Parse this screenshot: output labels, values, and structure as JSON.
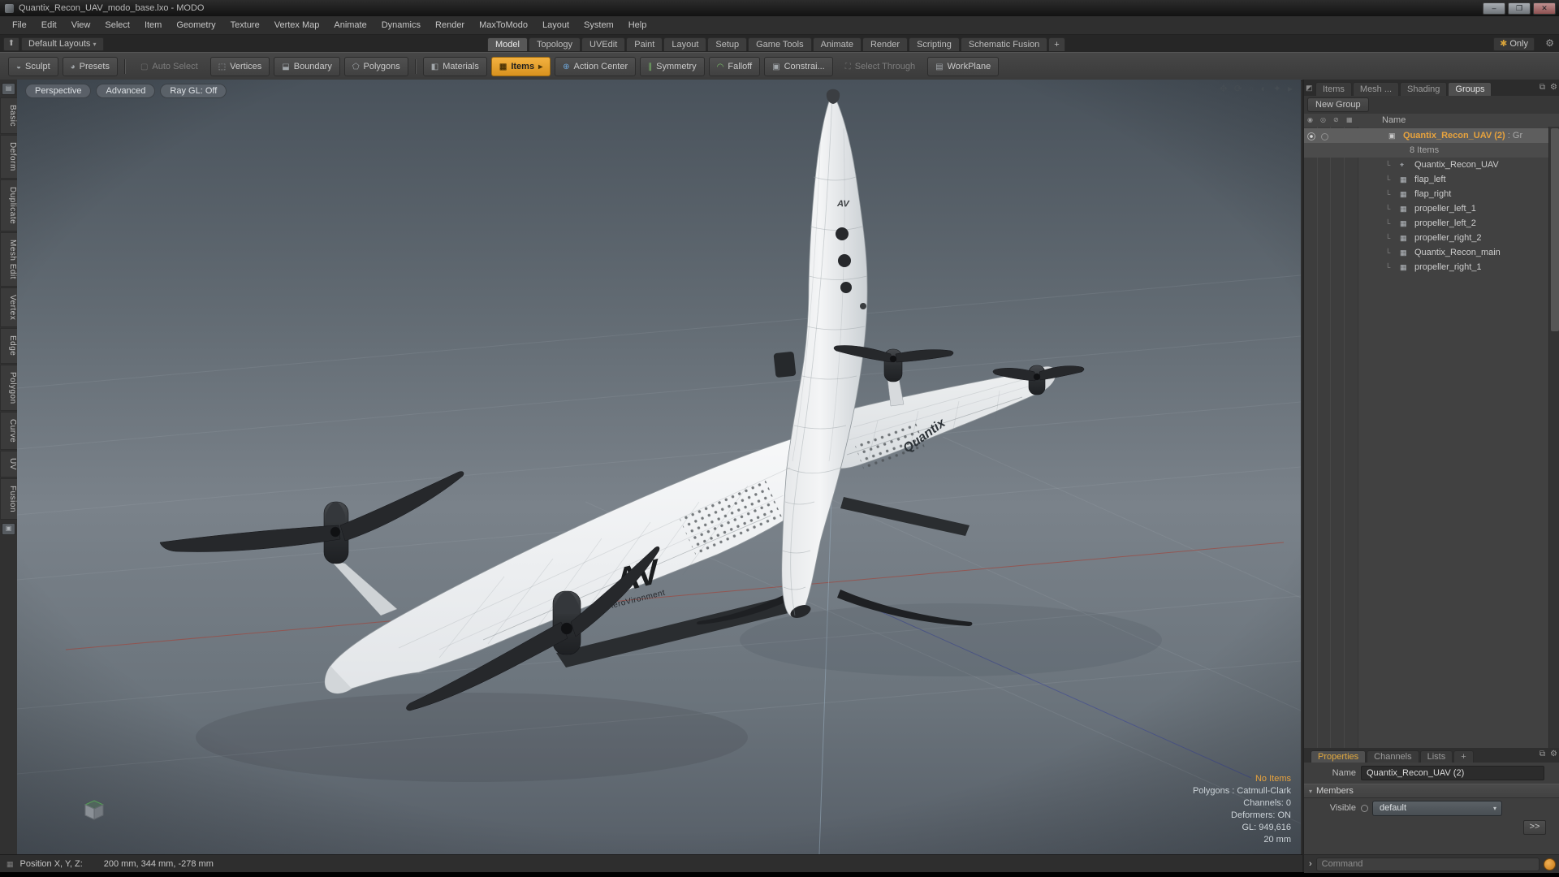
{
  "window": {
    "title": "Quantix_Recon_UAV_modo_base.lxo - MODO",
    "minimize": "–",
    "maximize": "❐",
    "close": "✕"
  },
  "menubar": {
    "items": [
      "File",
      "Edit",
      "View",
      "Select",
      "Item",
      "Geometry",
      "Texture",
      "Vertex Map",
      "Animate",
      "Dynamics",
      "Render",
      "MaxToModo",
      "Layout",
      "System",
      "Help"
    ]
  },
  "layout_row": {
    "default_layouts": "Default Layouts",
    "tabs": [
      "Model",
      "Topology",
      "UVEdit",
      "Paint",
      "Layout",
      "Setup",
      "Game Tools",
      "Animate",
      "Render",
      "Scripting",
      "Schematic Fusion"
    ],
    "add_tab": "+",
    "only": "Only"
  },
  "toolbar": {
    "sculpt": "Sculpt",
    "presets": "Presets",
    "auto_select": "Auto Select",
    "vertices": "Vertices",
    "boundary": "Boundary",
    "polygons": "Polygons",
    "materials": "Materials",
    "items": "Items",
    "action_center": "Action Center",
    "symmetry": "Symmetry",
    "falloff": "Falloff",
    "constraints": "Constrai...",
    "select_through": "Select Through",
    "workplane": "WorkPlane"
  },
  "left_tabs": {
    "items": [
      "Basic",
      "Deform",
      "Duplicate",
      "Mesh Edit",
      "Vertex",
      "Edge",
      "Polygon",
      "Curve",
      "UV",
      "Fusion"
    ]
  },
  "viewport": {
    "buttons": {
      "perspective": "Perspective",
      "advanced": "Advanced",
      "raygl": "Ray GL: Off"
    },
    "info": {
      "no_items": "No Items",
      "polygons": "Polygons : Catmull-Clark",
      "channels": "Channels: 0",
      "deformers": "Deformers: ON",
      "gl": "GL: 949,616",
      "grid_size": "20 mm"
    },
    "decals": {
      "av": "AV",
      "aerovironment": "AeroVironment",
      "quantix": "Quantix",
      "av_small": "AV"
    }
  },
  "right_panel": {
    "tabs": [
      "Items",
      "Mesh ...",
      "Shading",
      "Groups"
    ],
    "new_group": "New Group",
    "name_header": "Name",
    "group": {
      "label": "Quantix_Recon_UAV (2)",
      "suffix": " : Gr",
      "count": "8 Items"
    },
    "items": [
      "Quantix_Recon_UAV",
      "flap_left",
      "flap_right",
      "propeller_left_1",
      "propeller_left_2",
      "propeller_right_2",
      "Quantix_Recon_main",
      "propeller_right_1"
    ]
  },
  "properties": {
    "tabs": [
      "Properties",
      "Channels",
      "Lists"
    ],
    "add_tab": "+",
    "name_label": "Name",
    "name_value": "Quantix_Recon_UAV (2)",
    "members": "Members",
    "visible_label": "Visible",
    "visible_value": "default",
    "expand": ">>"
  },
  "command": {
    "prompt": "›",
    "placeholder": "Command"
  },
  "status": {
    "label": "Position X, Y, Z:",
    "value": "200 mm, 344 mm, -278 mm"
  },
  "icons": {
    "up_arrow": "⬆",
    "dropdown": "▾",
    "star": "✱",
    "gear": "⚙",
    "sculpt": "◒",
    "presets": "◕",
    "auto_select": "▢",
    "vertices": "⬚",
    "boundary": "⬓",
    "polygons": "⬠",
    "materials": "◧",
    "items": "▦",
    "action_center": "⊕",
    "symmetry": "∥",
    "falloff": "◠",
    "constraints": "▣",
    "select_through": "⛶",
    "workplane": "▤",
    "arrow_right": "▸",
    "palette": "▤",
    "package": "▣",
    "pan": "✥",
    "rotate": "⟳",
    "zoom": "⌕",
    "shade": "◐",
    "spark": "✦",
    "more": "▸",
    "eye": "◉",
    "shade_dot": "◎",
    "lock": "⊘",
    "cube": "▦",
    "locator": "⌖",
    "group": "▣",
    "branch": "└",
    "corner": "◩",
    "popout": "⧉",
    "grid": "▦",
    "section_arrow": "▾"
  },
  "colors": {
    "accent": "#e8a33d"
  }
}
